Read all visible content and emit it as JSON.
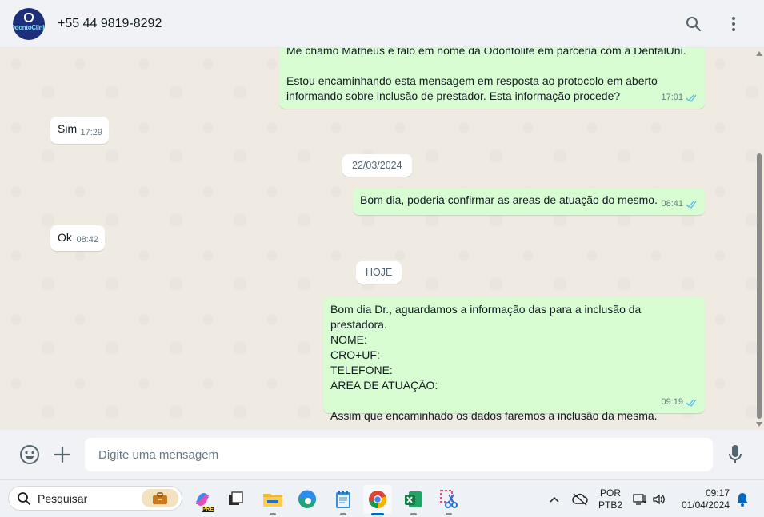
{
  "header": {
    "avatar_text": "OdontoClinic",
    "contact": "+55 44 9819-8292",
    "icons": [
      "search-icon",
      "menu-dots-icon"
    ]
  },
  "messages": [
    {
      "id": "m1",
      "dir": "out",
      "text_top": "Me chamo Matheus e falo em nome da Odontolife em parceria com a DentalUni.",
      "text": "Estou encaminhando esta mensagem em resposta ao protocolo em aberto\ninformando sobre inclusão de prestador. Esta informação procede?",
      "time": "17:01"
    },
    {
      "id": "m2",
      "dir": "in",
      "text": "Sim",
      "time": "17:29"
    },
    {
      "id": "m3",
      "dir": "out",
      "text": "Bom dia, poderia confirmar as areas de atuação do mesmo.",
      "time": "08:41"
    },
    {
      "id": "m4",
      "dir": "in",
      "text": "Ok",
      "time": "08:42"
    },
    {
      "id": "m5",
      "dir": "out",
      "text": "Bom dia Dr., aguardamos a informação das para a inclusão da prestadora.\nNOME:\nCRO+UF:\nTELEFONE:\nÁREA DE ATUAÇÃO:\n\nAssim que encaminhado os dados faremos a inclusão da mesma.",
      "time": "09:19"
    }
  ],
  "dates": {
    "d1": "22/03/2024",
    "d2": "HOJE"
  },
  "composer": {
    "placeholder": "Digite uma mensagem",
    "icons": [
      "emoji-icon",
      "plus-icon",
      "microphone-icon"
    ]
  },
  "taskbar": {
    "search_placeholder": "Pesquisar",
    "apps": [
      "copilot-icon",
      "task-view-icon",
      "file-explorer-icon",
      "edge-icon",
      "notepad-icon",
      "chrome-icon",
      "excel-icon",
      "snipping-tool-icon"
    ],
    "lang_line1": "POR",
    "lang_line2": "PTB2",
    "time": "09:17",
    "date": "01/04/2024"
  },
  "colors": {
    "outgoing_bubble": "#d9fdd3",
    "incoming_bubble": "#ffffff",
    "chat_background": "#efeae2",
    "read_ticks": "#53bdeb"
  }
}
